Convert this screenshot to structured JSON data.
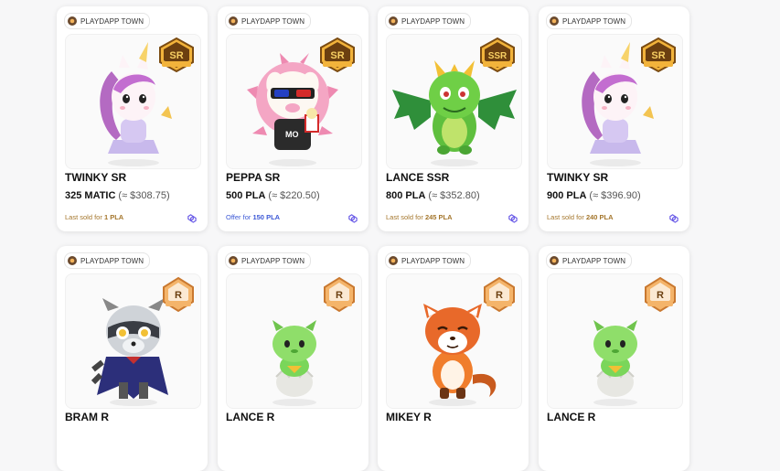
{
  "colors": {
    "sold": "#a4762c",
    "offer": "#3d59d6",
    "chain": "#6b5ce7"
  },
  "cards": [
    {
      "collection": "PLAYDAPP TOWN",
      "rarity": "SR",
      "character": "twinky",
      "name": "TWINKY SR",
      "price": "325 MATIC",
      "fiat": "(≈ $308.75)",
      "status_label": "Last sold for",
      "status_value": "1 PLA",
      "status_type": "sold",
      "chain_icon": "polygon-icon"
    },
    {
      "collection": "PLAYDAPP TOWN",
      "rarity": "SR",
      "character": "peppa",
      "name": "PEPPA SR",
      "price": "500 PLA",
      "fiat": "(≈ $220.50)",
      "status_label": "Offer for",
      "status_value": "150 PLA",
      "status_type": "offer",
      "chain_icon": "polygon-icon"
    },
    {
      "collection": "PLAYDAPP TOWN",
      "rarity": "SSR",
      "character": "lance-dragon",
      "name": "LANCE SSR",
      "price": "800 PLA",
      "fiat": "(≈ $352.80)",
      "status_label": "Last sold for",
      "status_value": "245 PLA",
      "status_type": "sold",
      "chain_icon": "polygon-icon"
    },
    {
      "collection": "PLAYDAPP TOWN",
      "rarity": "SR",
      "character": "twinky",
      "name": "TWINKY SR",
      "price": "900 PLA",
      "fiat": "(≈ $396.90)",
      "status_label": "Last sold for",
      "status_value": "240 PLA",
      "status_type": "sold",
      "chain_icon": "polygon-icon"
    },
    {
      "collection": "PLAYDAPP TOWN",
      "rarity": "R",
      "character": "bram",
      "name": "BRAM R"
    },
    {
      "collection": "PLAYDAPP TOWN",
      "rarity": "R",
      "character": "lance-baby",
      "name": "LANCE R"
    },
    {
      "collection": "PLAYDAPP TOWN",
      "rarity": "R",
      "character": "mikey",
      "name": "MIKEY R"
    },
    {
      "collection": "PLAYDAPP TOWN",
      "rarity": "R",
      "character": "lance-baby",
      "name": "LANCE R"
    }
  ]
}
